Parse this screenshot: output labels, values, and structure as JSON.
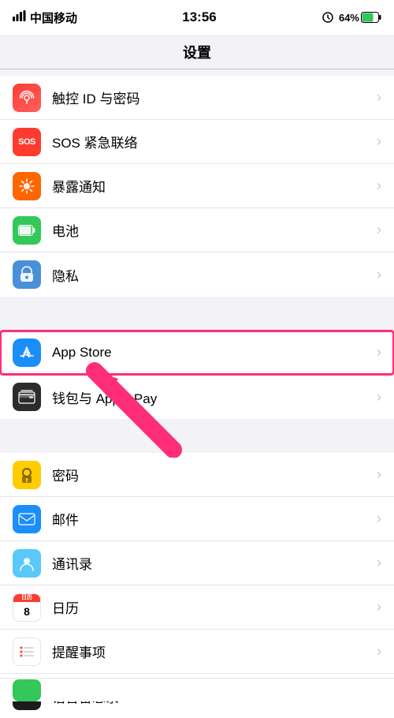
{
  "statusBar": {
    "carrier": "中国移动",
    "time": "13:56",
    "battery": "64%"
  },
  "navTitle": "设置",
  "sections": [
    {
      "rows": [
        {
          "id": "touch-id",
          "icon": "touch-id",
          "label": "触控 ID 与密码",
          "iconBg": "#ff3b30",
          "iconChar": "👆"
        },
        {
          "id": "sos",
          "icon": "sos",
          "label": "SOS 紧急联络",
          "iconBg": "#ff3b30",
          "iconChar": "SOS"
        },
        {
          "id": "exposure",
          "icon": "exposure",
          "label": "暴露通知",
          "iconBg": "#ff6600",
          "iconChar": "☀"
        },
        {
          "id": "battery",
          "icon": "battery",
          "label": "电池",
          "iconBg": "#34c759",
          "iconChar": "🔋"
        },
        {
          "id": "privacy",
          "icon": "privacy",
          "label": "隐私",
          "iconBg": "#4a90d9",
          "iconChar": "✋"
        }
      ]
    },
    {
      "rows": [
        {
          "id": "appstore",
          "icon": "appstore",
          "label": "App Store",
          "iconBg": "#1c8ef9",
          "iconChar": "A",
          "highlighted": true
        },
        {
          "id": "wallet",
          "icon": "wallet",
          "label": "钱包与 Apple Pay",
          "iconBg": "#2c2c2e",
          "iconChar": "💳"
        }
      ]
    },
    {
      "rows": [
        {
          "id": "passwords",
          "icon": "passwords",
          "label": "密码",
          "iconBg": "#ffcc00",
          "iconChar": "🔑"
        },
        {
          "id": "mail",
          "icon": "mail",
          "label": "邮件",
          "iconBg": "#1c8ef9",
          "iconChar": "✉"
        },
        {
          "id": "contacts",
          "icon": "contacts",
          "label": "通讯录",
          "iconBg": "#5ac8fa",
          "iconChar": "👤"
        },
        {
          "id": "calendar",
          "icon": "calendar",
          "label": "日历",
          "iconBg": "#ff3b30",
          "iconChar": "📅"
        },
        {
          "id": "reminders",
          "icon": "reminders",
          "label": "提醒事项",
          "iconBg": "#ff3b30",
          "iconChar": "•"
        },
        {
          "id": "voice-memo",
          "icon": "voice-memo",
          "label": "语音备忘录",
          "iconBg": "#1c1c1e",
          "iconChar": "🎙"
        }
      ]
    }
  ],
  "chevron": "›"
}
